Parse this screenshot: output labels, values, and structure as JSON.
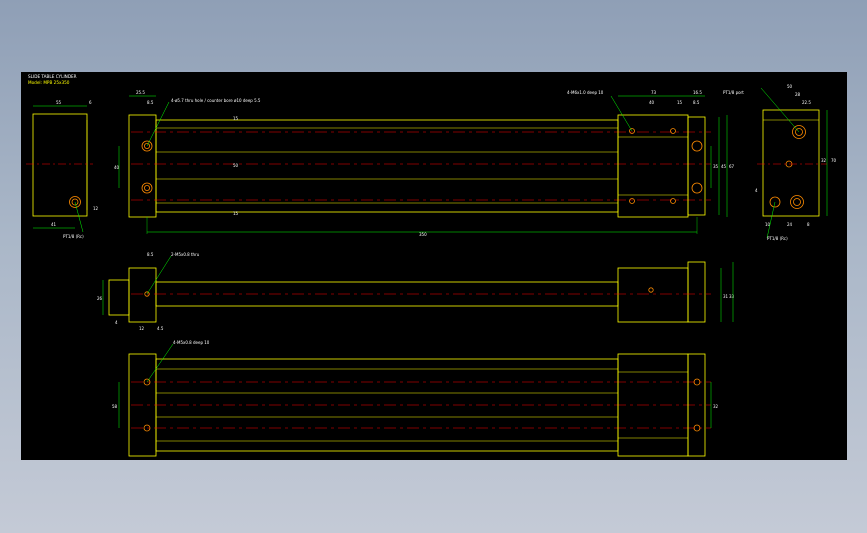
{
  "title_block": {
    "line1": "SLIDE TABLE CYLINDER",
    "line2": "Model: MPB 25x350"
  },
  "colors": {
    "background": "#000000",
    "outline": "#ffff00",
    "centerline": "#ff0000",
    "dimension": "#00ff00",
    "hole": "#ff8c00",
    "frame": "#9aa8bd"
  },
  "notes": {
    "top_left_holes": "4-ø5.7 thru hole / counter bore ø10 deep 5.5",
    "top_right_holes": "4-M6x1.0 deep 10",
    "right_ports": "PT1/8 port",
    "port_left_end": "PT1/8 (Rc)",
    "port_right_end": "PT1/8 (Rc)",
    "front_holes": "2-M5x0.8 thru",
    "bottom_holes": "4-M5x0.8 deep 10"
  },
  "dims": {
    "d55": "55",
    "d6": "6",
    "d41": "41",
    "d12": "12",
    "d25_5": "25.5",
    "d8_5": "8.5",
    "d350": "350",
    "d73": "73",
    "d40": "40",
    "d15": "15",
    "d16_5": "16.5",
    "d35": "35",
    "d50": "50",
    "d45": "45",
    "d67": "67",
    "d28": "28",
    "d22_5": "22.5",
    "d70": "70",
    "d32": "32",
    "d4": "4",
    "d10": "10",
    "d24": "24",
    "d8": "8",
    "d26": "26",
    "d4_5": "4.5",
    "d31": "31",
    "d33": "33",
    "d50b": "50",
    "d32b": "32",
    "d58": "58"
  }
}
